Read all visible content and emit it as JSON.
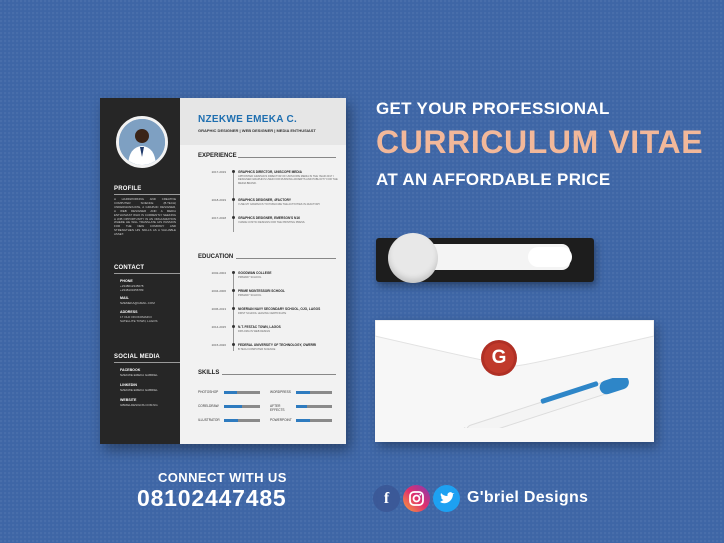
{
  "cv": {
    "name": "NZEKWE EMEKA C.",
    "subtitle": "GRAPHIC DESIGNER | WEB DESIGNER | MEDIA ENTHUSIAST",
    "profile_heading": "PROFILE",
    "profile_text": "A HARDWORKING AND CREATIVE COMPUTER SCIENCE (B.TECH) UNDERGRADUATE, A GRAPHIC DESIGNER, A WEB DESIGNER AND A MEDIA ENTHUSIAST WHO IS CURRENTLY SEEKING A JOB OPPORTUNITY IN AN ORGANIZATION WHERE HE WILL TRANSLATE HIS PASSION FOR THE NEW COMPANY AND STRENGTHEN HIS SKILLS AS A VALUABLE ASSET.",
    "contact_heading": "CONTACT",
    "phone_label": "PHONE",
    "phone_values": "+2348012345678\n+2348103456789",
    "mail_label": "MAIL",
    "mail_value": "NZEMEKA@GMAIL.COM",
    "address_label": "ADDRESS",
    "address_value": "17 OLD OKOKOMAIKO\nSATELLITE TOWN, LAGOS",
    "social_heading": "SOCIAL MEDIA",
    "facebook_label": "FACEBOOK",
    "facebook_value": "NZEKWE EMEKA GABRIEL",
    "linkedin_label": "LINKEDIN",
    "linkedin_value": "NZEKWE EMEKA GABRIEL",
    "website_label": "WEBSITE",
    "website_value": "GBRIELDESIGNS.COM.NG",
    "experience_heading": "EXPERIENCE",
    "experience": [
      {
        "date": "2017-2019",
        "title": "GRAPHICS DIRECTOR, UNISCOPE MEDIA",
        "desc": "APPOINTED GRAPHICS DIRECTOR OF UNISCOPE MEDIA IN THE YEAR 2017 I DESIGNED GRAPHICS USED FOR RUNNING ADVERTS AND PUBLICITY FOR THE MEDIA BRAND."
      },
      {
        "date": "2018-2019",
        "title": "GRAPHICS DESIGNER, 4FACTORY",
        "desc": "I USE MY GRAPHICS TO PUBLICIZE THE ACTIVITIES IN 4FACTORY"
      },
      {
        "date": "2017-2018",
        "title": "GRAPHICS DESIGNER, EMERSON'S N16",
        "desc": "I MADE COSTIC DESIGNS FOR THE PRINTING PRESS."
      }
    ],
    "education_heading": "EDUCATION",
    "education": [
      {
        "date": "2002-2004",
        "title": "GOODWAN COLLEGE",
        "desc": "PRIMARY SCHOOL"
      },
      {
        "date": "2004-2006",
        "title": "PRIME MONTESSORI SCHOOL",
        "desc": "PRIMARY SCHOOL"
      },
      {
        "date": "2006-2013",
        "title": "NIGERIAN NAVY SECONDARY SCHOOL, OJO, LAGOS",
        "desc": "FIRST SCHOOL LEAVING CERTIFICATE"
      },
      {
        "date": "2014-2015",
        "title": "N.T. FESTAC TOWN, LAGOS",
        "desc": "DIPLOMA IN WEB DESIGN"
      },
      {
        "date": "2015-2020",
        "title": "FEDERAL UNIVERSITY OF TECHNOLOGY, OWERRI",
        "desc": "B.TECH COMPUTER SCIENCE"
      }
    ],
    "skills_heading": "SKILLS",
    "skills": [
      {
        "name": "PHOTOSHOP",
        "level": 0.35
      },
      {
        "name": "WORDPRESS",
        "level": 0.4
      },
      {
        "name": "CORELDRAW",
        "level": 0.5
      },
      {
        "name": "AFTER EFFECTS",
        "level": 0.3
      },
      {
        "name": "ILLUSTRATOR",
        "level": 0.4
      },
      {
        "name": "POWERPOINT",
        "level": 0.4
      }
    ]
  },
  "headline": {
    "line1": "GET YOUR PROFESSIONAL",
    "line2": "CURRICULUM VITAE",
    "line3": "AT AN AFFORDABLE PRICE"
  },
  "seal_letter": "G",
  "footer": {
    "connect": "CONNECT WITH US",
    "phone": "08102447485",
    "brand": "G'briel Designs"
  },
  "colors": {
    "background": "#3e66a6",
    "accent_blue": "#1f6fb0",
    "peach": "#f2b89a",
    "seal_red": "#c0392b"
  }
}
